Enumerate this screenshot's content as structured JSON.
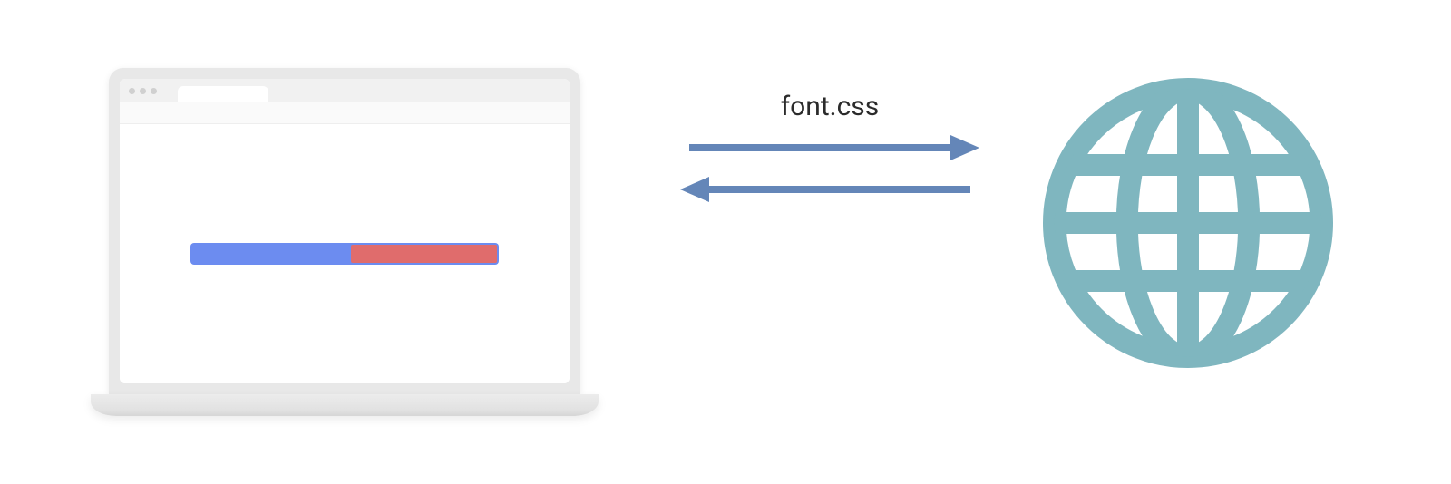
{
  "diagram": {
    "arrow_label": "font.css",
    "colors": {
      "arrow": "#6486b8",
      "globe": "#7fb6bf",
      "progress_bg": "#6c8cf0",
      "progress_fg": "#e06c6c",
      "laptop_frame": "#e8e8e8"
    },
    "icons": {
      "globe": "globe-icon",
      "arrow_right": "arrow-right-icon",
      "arrow_left": "arrow-left-icon",
      "laptop": "laptop-icon"
    }
  }
}
